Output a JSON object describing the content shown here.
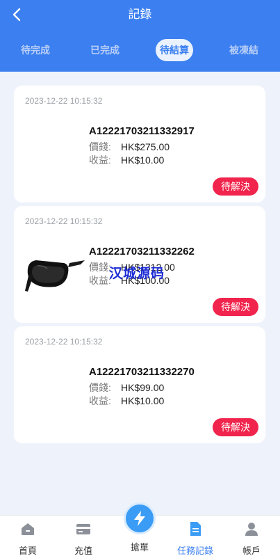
{
  "header": {
    "title": "記錄"
  },
  "tabs": [
    {
      "label": "待完成"
    },
    {
      "label": "已完成"
    },
    {
      "label": "待結算"
    },
    {
      "label": "被凍結"
    }
  ],
  "orders": [
    {
      "time": "2023-12-22 10:15:32",
      "order_no": "A12221703211332917",
      "price_label": "價錢:",
      "price": "HK$275.00",
      "income_label": "收益:",
      "income": "HK$10.00",
      "action": "待解決"
    },
    {
      "time": "2023-12-22 10:15:32",
      "order_no": "A12221703211332262",
      "price_label": "價錢:",
      "price": "HK$1312.00",
      "income_label": "收益:",
      "income": "HK$100.00",
      "action": "待解決"
    },
    {
      "time": "2023-12-22 10:15:32",
      "order_no": "A12221703211332270",
      "price_label": "價錢:",
      "price": "HK$99.00",
      "income_label": "收益:",
      "income": "HK$10.00",
      "action": "待解決"
    }
  ],
  "watermark": "汉城源码",
  "nav": [
    {
      "label": "首頁",
      "icon": "home-icon"
    },
    {
      "label": "充值",
      "icon": "card-icon"
    },
    {
      "label": "搶單",
      "icon": "lightning-icon"
    },
    {
      "label": "任務記錄",
      "icon": "document-icon"
    },
    {
      "label": "帳戶",
      "icon": "user-icon"
    }
  ],
  "colors": {
    "primary": "#3b7ff0",
    "danger": "#f0244c",
    "background": "#eef3fb"
  }
}
